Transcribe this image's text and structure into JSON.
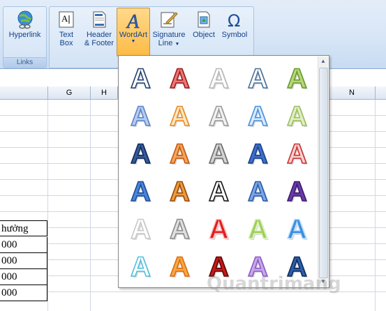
{
  "ribbon": {
    "groups": [
      {
        "label": "Links"
      }
    ],
    "buttons": {
      "hyperlink": "Hyperlink",
      "textbox": [
        "Text",
        "Box"
      ],
      "header_footer": [
        "Header",
        "& Footer"
      ],
      "wordart": "WordArt",
      "signature_line": [
        "Signature",
        "Line"
      ],
      "object": "Object",
      "symbol": "Symbol"
    }
  },
  "sheet": {
    "columns": [
      "G",
      "H",
      "N"
    ],
    "cells": [
      "hưởng",
      "000",
      "000",
      "000",
      "000"
    ]
  },
  "gallery": {
    "letter": "A",
    "styles": [
      [
        "outline-blue",
        "red-gradient",
        "white-shadow",
        "outline-light",
        "green-gradient"
      ],
      [
        "light-blue-gradient",
        "orange-outline",
        "gray-outline",
        "sky-outline",
        "light-green"
      ],
      [
        "dark-blue-bevel",
        "orange-bevel",
        "silver-bevel",
        "blue-solid",
        "red-stripe"
      ],
      [
        "blue-3d",
        "orange-3d",
        "black-outline",
        "blue-shadow",
        "purple-perspective"
      ],
      [
        "white-gray",
        "gray-metal",
        "red-glow",
        "green-glow",
        "blue-glow"
      ],
      [
        "aqua-outline",
        "orange-gradient",
        "red-dark",
        "lavender",
        "navy-reflect"
      ]
    ]
  },
  "watermark": "Quantrimang",
  "colors": {
    "active_button": "#fdbb47",
    "ribbon": "#d6e5f6"
  }
}
